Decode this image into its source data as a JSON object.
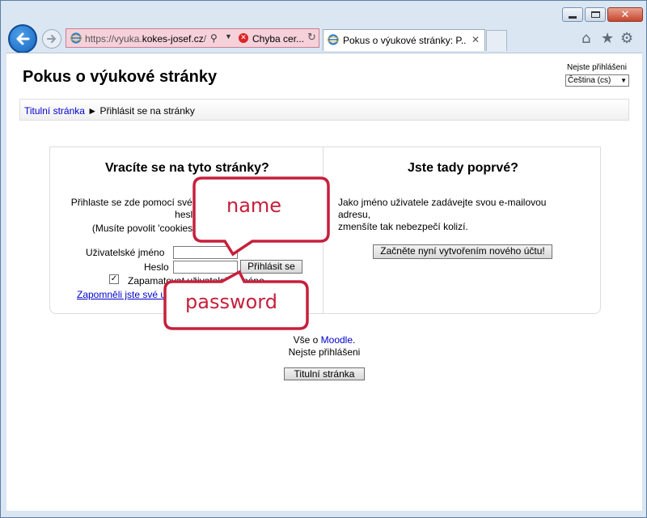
{
  "browser": {
    "address": {
      "prefix": "https://vyuka.",
      "domain": "kokes-josef.cz",
      "suffix": "/"
    },
    "cert_error": "Chyba cer...",
    "tab_title": "Pokus o výukové stránky: P..."
  },
  "page": {
    "title": "Pokus o výukové stránky",
    "login_status": "Nejste přihlášeni",
    "language": "Čeština (cs)"
  },
  "breadcrumb": {
    "home": "Titulní stránka",
    "separator": "►",
    "current": "Přihlásit se na stránky"
  },
  "login": {
    "heading": "Vracíte se na tyto stránky?",
    "intro_line1": "Přihlaste se zde pomocí svého uživatelského jména a",
    "intro_line2": "hesla",
    "intro_line3": "(Musíte povolit 'cookies' ve svém prohlížeči)",
    "username_label": "Uživatelské jméno",
    "password_label": "Heslo",
    "login_button": "Přihlásit se",
    "remember_label": "Zapamatovat uživatelské jméno",
    "forgot_link": "Zapomněli jste své uživatelské jméno nebo heslo?"
  },
  "signup": {
    "heading": "Jste tady poprvé?",
    "text_line1": "Jako jméno uživatele zadávejte svou e-mailovou",
    "text_line2": "adresu,",
    "text_line3": "zmenšíte tak nebezpečí kolizí.",
    "create_button": "Začněte nyní vytvořením nového účtu!"
  },
  "footer": {
    "about_prefix": "Vše o ",
    "about_link": "Moodle",
    "about_suffix": ".",
    "status": "Nejste přihlášeni",
    "home_button": "Titulní stránka"
  },
  "annotations": {
    "name": "name",
    "password": "password",
    "color": "#c6203c"
  }
}
